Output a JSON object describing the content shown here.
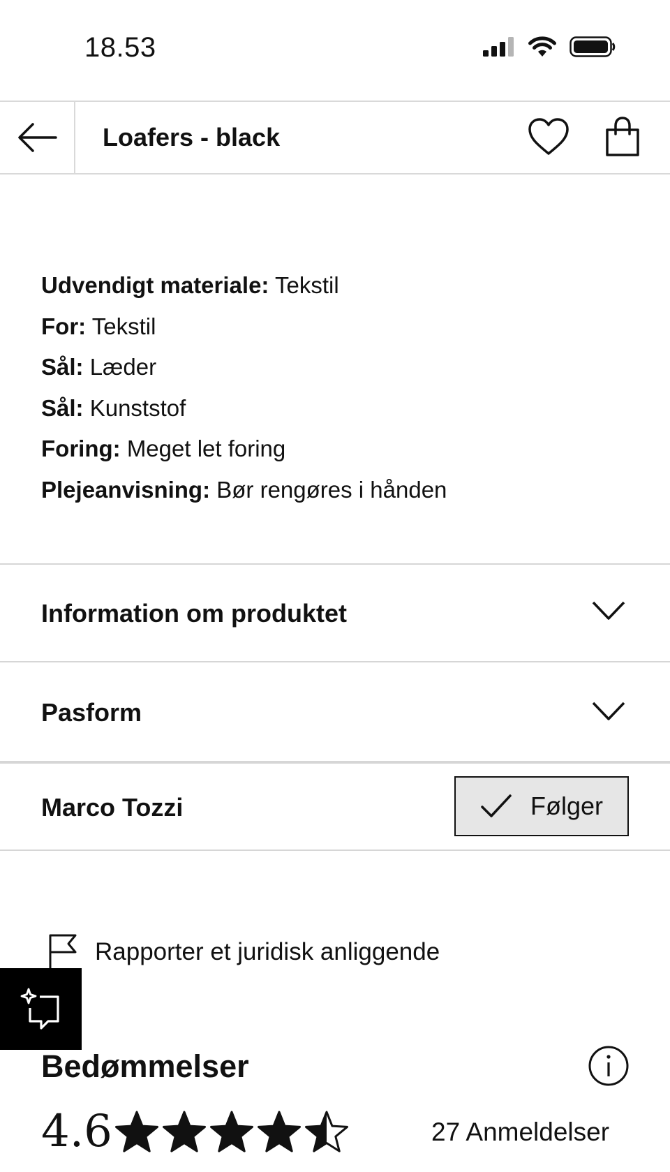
{
  "status_bar": {
    "time": "18.53",
    "icons": [
      "cellular-signal-icon",
      "wifi-icon",
      "battery-icon"
    ]
  },
  "nav": {
    "title": "Loafers - black",
    "back_icon": "arrow-left-icon",
    "wishlist_icon": "heart-icon",
    "bag_icon": "shopping-bag-icon"
  },
  "details": [
    {
      "label": "Udvendigt materiale:",
      "value": "Tekstil"
    },
    {
      "label": "For:",
      "value": "Tekstil"
    },
    {
      "label": "Sål:",
      "value": "Læder"
    },
    {
      "label": "Sål:",
      "value": "Kunststof"
    },
    {
      "label": "Foring:",
      "value": "Meget let foring"
    },
    {
      "label": "Plejeanvisning:",
      "value": "Bør rengøres i hånden"
    }
  ],
  "accordions": [
    {
      "label": "Information om produktet",
      "icon": "chevron-down-icon"
    },
    {
      "label": "Pasform",
      "icon": "chevron-down-icon"
    }
  ],
  "brand": {
    "name": "Marco Tozzi",
    "follow_label": "Følger",
    "follow_icon": "checkmark-icon"
  },
  "report": {
    "label": "Rapporter et juridisk anliggende",
    "icon": "flag-icon"
  },
  "ai_button": {
    "icon": "sparkle-review-icon"
  },
  "ratings": {
    "title": "Bedømmelser",
    "value": "4.6",
    "stars_rating": 4.6,
    "stars_max": 5,
    "count_label": "27 Anmeldelser",
    "info_icon": "info-icon"
  }
}
